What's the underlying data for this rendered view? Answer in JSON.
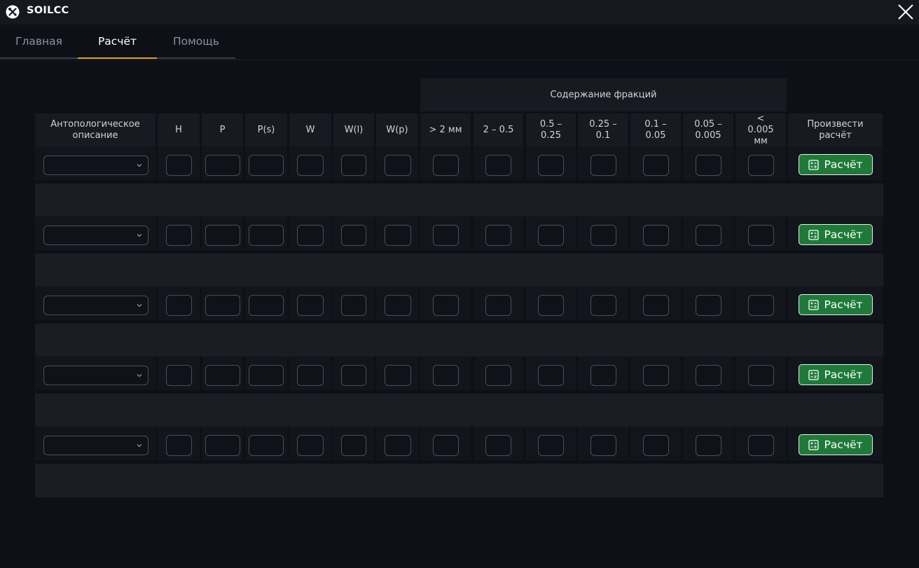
{
  "window": {
    "title": "SOILCC",
    "logo_icon": "tools-icon",
    "close_icon": "close-icon"
  },
  "tabs": [
    {
      "label": "Главная",
      "active": false
    },
    {
      "label": "Расчёт",
      "active": true
    },
    {
      "label": "Помощь",
      "active": false
    }
  ],
  "table": {
    "group_header": "Содержание фракций",
    "columns": [
      {
        "label": "Антопологическое описание"
      },
      {
        "label": "H"
      },
      {
        "label": "P"
      },
      {
        "label": "P(s)"
      },
      {
        "label": "W"
      },
      {
        "label": "W(l)"
      },
      {
        "label": "W(p)"
      },
      {
        "label": "> 2 мм"
      },
      {
        "label": "2 – 0.5"
      },
      {
        "label": "0.5 – 0.25"
      },
      {
        "label": "0.25 – 0.1"
      },
      {
        "label": "0.1 – 0.05"
      },
      {
        "label": "0.05 – 0.005"
      },
      {
        "label": "< 0.005 мм"
      },
      {
        "label": "Произвести расчёт"
      }
    ],
    "rows": [
      {
        "select_value": "",
        "values": [
          "",
          "",
          "",
          "",
          "",
          "",
          "",
          "",
          "",
          "",
          "",
          ""
        ],
        "button_label": "Расчёт"
      },
      {
        "select_value": "",
        "values": [
          "",
          "",
          "",
          "",
          "",
          "",
          "",
          "",
          "",
          "",
          "",
          ""
        ],
        "button_label": "Расчёт"
      },
      {
        "select_value": "",
        "values": [
          "",
          "",
          "",
          "",
          "",
          "",
          "",
          "",
          "",
          "",
          "",
          ""
        ],
        "button_label": "Расчёт"
      },
      {
        "select_value": "",
        "values": [
          "",
          "",
          "",
          "",
          "",
          "",
          "",
          "",
          "",
          "",
          "",
          ""
        ],
        "button_label": "Расчёт"
      },
      {
        "select_value": "",
        "values": [
          "",
          "",
          "",
          "",
          "",
          "",
          "",
          "",
          "",
          "",
          "",
          ""
        ],
        "button_label": "Расчёт"
      }
    ],
    "button_icon": "calculator-icon"
  },
  "colors": {
    "background": "#0d1016",
    "accent": "#e2a21d",
    "button": "#1f7a3a"
  }
}
